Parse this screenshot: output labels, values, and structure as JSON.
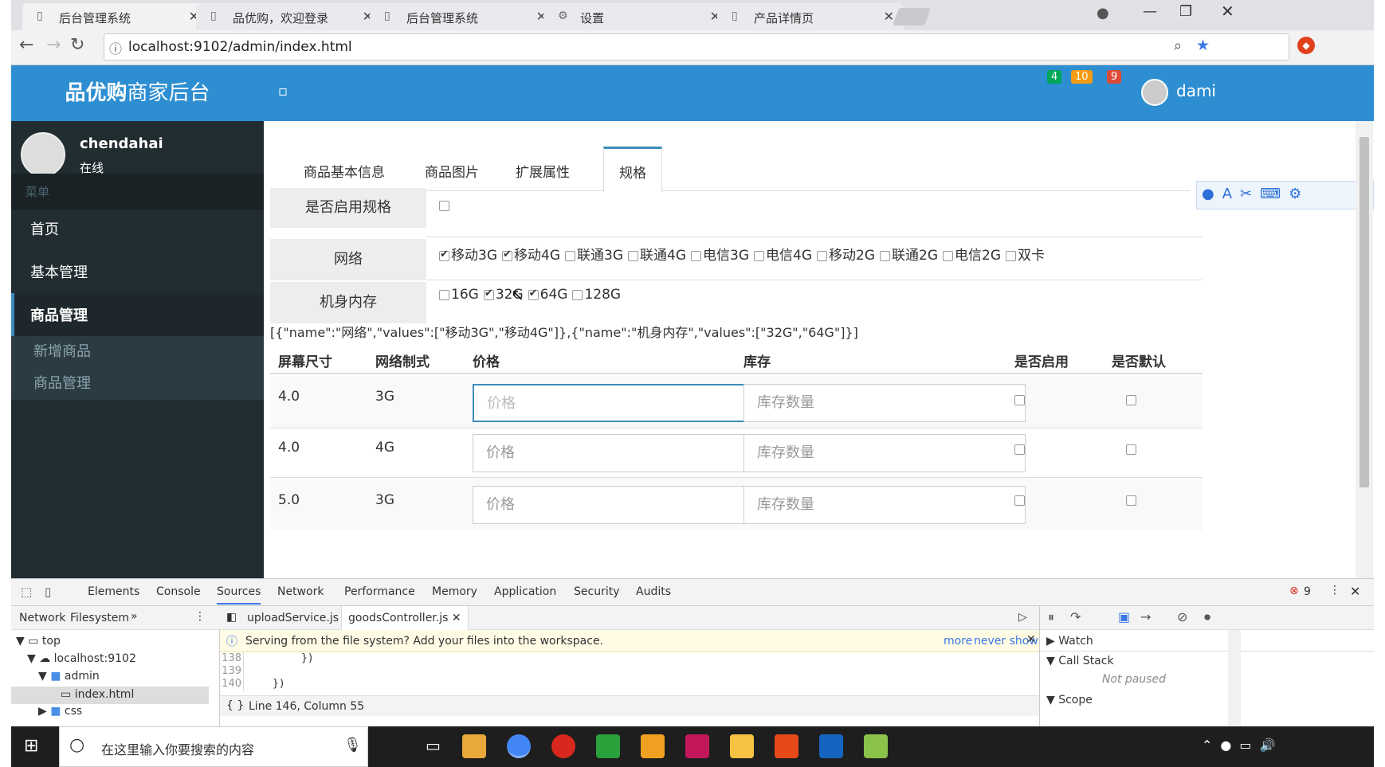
{
  "browser": {
    "tabs": [
      {
        "title": "后台管理系统",
        "close": "✕"
      },
      {
        "title": "品优购，欢迎登录",
        "close": "✕"
      },
      {
        "title": "后台管理系统",
        "close": "✕"
      },
      {
        "title": "设置",
        "close": "✕"
      },
      {
        "title": "产品详情页",
        "close": "✕"
      }
    ],
    "url": "localhost:9102/admin/index.html"
  },
  "header": {
    "brand_bold": "品优购",
    "brand_rest": "商家后台",
    "toggle": "▫",
    "badges": [
      {
        "text": "4",
        "color": "#00a65a"
      },
      {
        "text": "10",
        "color": "#f39c12"
      },
      {
        "text": "9",
        "color": "#dd4b39"
      }
    ],
    "username": "dami"
  },
  "sidebar": {
    "user_name": "chendahai",
    "user_status": "在线",
    "section": "菜单",
    "items": [
      "首页",
      "基本管理",
      "商品管理"
    ],
    "subitems": [
      "新增商品",
      "商品管理"
    ]
  },
  "content": {
    "tabs": [
      "商品基本信息",
      "商品图片",
      "扩展属性",
      "规格"
    ],
    "row_enable_label": "是否启用规格",
    "row_network_label": "网络",
    "network_options": [
      {
        "label": "移动3G",
        "checked": true
      },
      {
        "label": "移动4G",
        "checked": true
      },
      {
        "label": "联通3G",
        "checked": false
      },
      {
        "label": "联通4G",
        "checked": false
      },
      {
        "label": "电信3G",
        "checked": false
      },
      {
        "label": "电信4G",
        "checked": false
      },
      {
        "label": "移动2G",
        "checked": false
      },
      {
        "label": "联通2G",
        "checked": false
      },
      {
        "label": "电信2G",
        "checked": false
      },
      {
        "label": "双卡",
        "checked": false
      }
    ],
    "row_memory_label": "机身内存",
    "memory_options": [
      {
        "label": "16G",
        "checked": false
      },
      {
        "label": "32G",
        "checked": true
      },
      {
        "label": "64G",
        "checked": true
      },
      {
        "label": "128G",
        "checked": false
      }
    ],
    "json_text": "[{\"name\":\"网络\",\"values\":[\"移动3G\",\"移动4G\"]},{\"name\":\"机身内存\",\"values\":[\"32G\",\"64G\"]}]",
    "table_headers": [
      "屏幕尺寸",
      "网络制式",
      "价格",
      "库存",
      "是否启用",
      "是否默认"
    ],
    "rows": [
      {
        "size": "4.0",
        "net": "3G"
      },
      {
        "size": "4.0",
        "net": "4G"
      },
      {
        "size": "5.0",
        "net": "3G"
      }
    ],
    "price_placeholder": "价格",
    "stock_placeholder": "库存数量"
  },
  "devtools": {
    "tabs": [
      "Elements",
      "Console",
      "Sources",
      "Network",
      "Performance",
      "Memory",
      "Application",
      "Security",
      "Audits"
    ],
    "error_count": "9",
    "nav_tabs": [
      "Network",
      "Filesystem",
      "»"
    ],
    "files": [
      "uploadService.js",
      "goodsController.js"
    ],
    "tree": [
      "top",
      "localhost:9102",
      "admin",
      "index.html",
      "css"
    ],
    "info": "Serving from the file system? Add your files into the workspace.",
    "info_more": "more",
    "info_never": "never show",
    "line_numbers": [
      "138",
      "139",
      "140"
    ],
    "code": [
      "})",
      "",
      "})"
    ],
    "status": "Line 146, Column 55",
    "watch": "Watch",
    "callstack": "Call Stack",
    "not_paused": "Not paused",
    "scope": "Scope"
  },
  "taskbar": {
    "search": "在这里输入你要搜索的内容"
  }
}
